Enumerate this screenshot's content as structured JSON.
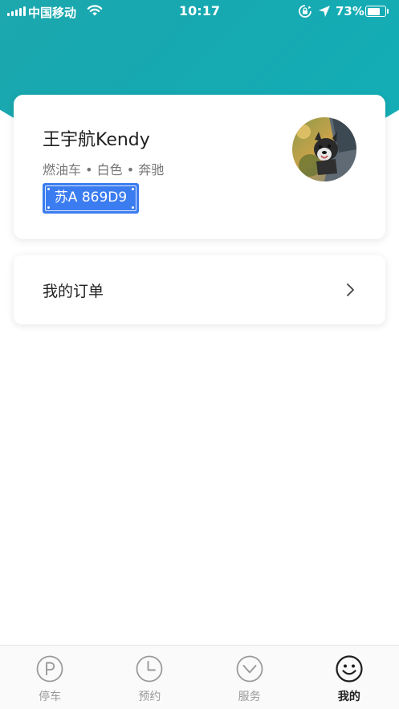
{
  "status_bar": {
    "carrier": "中国移动",
    "time": "10:17",
    "battery_percent": "73%",
    "battery_level": 0.73
  },
  "profile": {
    "name": "王宇航Kendy",
    "car_info": "燃油车 • 白色 • 奔驰",
    "plate": "苏A 869D9",
    "plate_color": "#3b7cf0",
    "avatar_icon": "avatar-photo-dog"
  },
  "orders": {
    "label": "我的订单",
    "icon": "chevron-right-icon"
  },
  "tabs": [
    {
      "label": "停车",
      "icon": "parking-icon",
      "active": false
    },
    {
      "label": "预约",
      "icon": "clock-icon",
      "active": false
    },
    {
      "label": "服务",
      "icon": "chevron-down-circle-icon",
      "active": false
    },
    {
      "label": "我的",
      "icon": "smiley-icon",
      "active": true
    }
  ],
  "colors": {
    "header_gradient_start": "#2aa7a5",
    "header_gradient_end": "#12b0b9",
    "tab_inactive": "#999999",
    "tab_active": "#222222"
  }
}
